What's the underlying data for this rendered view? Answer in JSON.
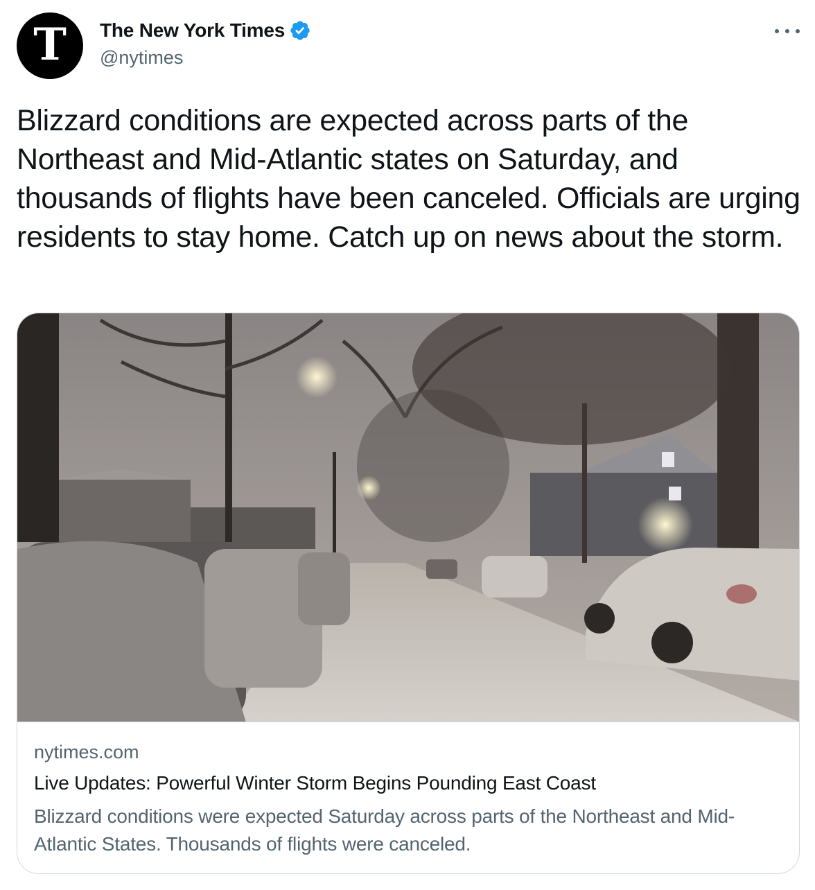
{
  "author": {
    "display_name": "The New York Times",
    "handle": "@nytimes",
    "avatar_letter": "ᵋ",
    "avatar_glyph": "T",
    "verified": true,
    "verified_color": "#1d9bf0"
  },
  "tweet": {
    "text": "Blizzard conditions are expected across parts of the Northeast and Mid-Atlantic states on Saturday, and thousands of flights have been canceled. Officials are urging residents to stay home. Catch up on news about the storm."
  },
  "card": {
    "image_icon": "snowy-street-photo",
    "domain": "nytimes.com",
    "title": "Live Updates: Powerful Winter Storm Begins Pounding East Coast",
    "description": "Blizzard conditions were expected Saturday across parts of the Northeast and Mid-Atlantic States. Thousands of flights were canceled."
  },
  "icons": {
    "more": "more-options-icon",
    "verified": "verified-badge-icon"
  },
  "colors": {
    "text_primary": "#0f1419",
    "text_secondary": "#536471",
    "border": "#cfd9de",
    "brand": "#000000",
    "verified": "#1d9bf0"
  }
}
